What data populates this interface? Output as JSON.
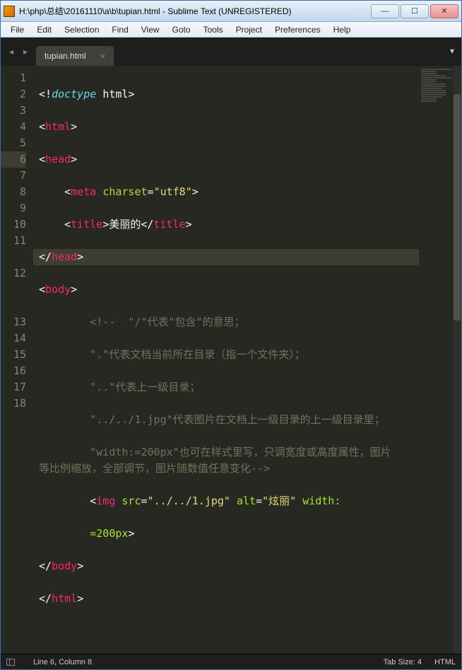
{
  "titlebar": {
    "title": "H:\\php\\总结\\20161110\\a\\b\\tupian.html - Sublime Text (UNREGISTERED)"
  },
  "menu": {
    "file": "File",
    "edit": "Edit",
    "selection": "Selection",
    "find": "Find",
    "view": "View",
    "goto": "Goto",
    "tools": "Tools",
    "project": "Project",
    "preferences": "Preferences",
    "help": "Help"
  },
  "tab": {
    "name": "tupian.html",
    "close": "×"
  },
  "lines": [
    "1",
    "2",
    "3",
    "4",
    "5",
    "6",
    "7",
    "8",
    "9",
    "10",
    "11",
    "12",
    "13",
    "14",
    "15",
    "16",
    "17",
    "18"
  ],
  "active_line": "6",
  "code": {
    "l1_doctype": "doctype",
    "l1_html": "html",
    "l2_html": "html",
    "l3_head": "head",
    "l4_meta": "meta",
    "l4_charset": "charset",
    "l4_val": "\"utf8\"",
    "l5_title_o": "title",
    "l5_text": "美丽的",
    "l5_title_c": "title",
    "l6_head": "head",
    "l7_body": "body",
    "l8": "        <!--  \"/\"代表\"包含\"的意思；",
    "l9": "        \".\"代表文档当前所在目录（指一个文件夹）；",
    "l10": "        \"..\"代表上一级目录；",
    "l11": "        \"../../1.jpg\"代表图片在文档上一级目录的上一级目录里；",
    "l12": "        \"width:=200px\"也可在样式里写，只调宽度或高度属性，图片等比例缩放，全部调节，图片随数值任意变化-->",
    "l13_img": "img",
    "l13_src": "src",
    "l13_srcv": "\"../../1.jpg\"",
    "l13_alt": "alt",
    "l13_altv": "\"炫丽\"",
    "l13_width": "width:",
    "l14": "=200px",
    "l15_body": "body",
    "l16_html": "html"
  },
  "status": {
    "pos": "Line 6, Column 8",
    "tabsize": "Tab Size: 4",
    "lang": "HTML"
  }
}
